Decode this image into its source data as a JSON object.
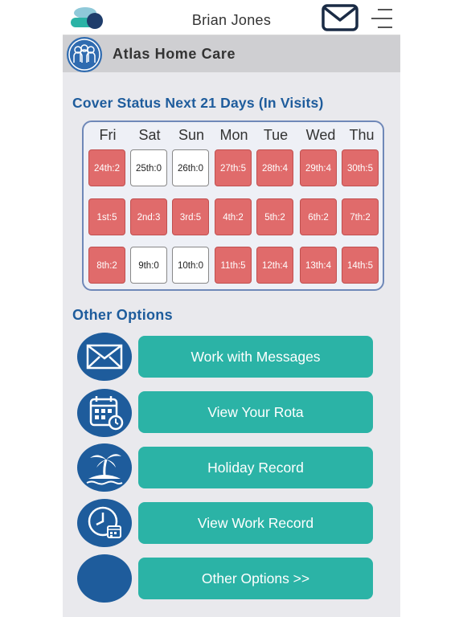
{
  "header": {
    "user_name": "Brian Jones"
  },
  "company": {
    "name": "Atlas Home Care"
  },
  "cover": {
    "title": "Cover Status Next 21 Days (In Visits)",
    "days": [
      "Fri",
      "Sat",
      "Sun",
      "Mon",
      "Tue",
      "Wed",
      "Thu"
    ],
    "weeks": [
      [
        {
          "label": "24th:2",
          "status": "red"
        },
        {
          "label": "25th:0",
          "status": "white"
        },
        {
          "label": "26th:0",
          "status": "white"
        },
        {
          "label": "27th:5",
          "status": "red"
        },
        {
          "label": "28th:4",
          "status": "red"
        },
        {
          "label": "29th:4",
          "status": "red"
        },
        {
          "label": "30th:5",
          "status": "red"
        }
      ],
      [
        {
          "label": "1st:5",
          "status": "red"
        },
        {
          "label": "2nd:3",
          "status": "red"
        },
        {
          "label": "3rd:5",
          "status": "red"
        },
        {
          "label": "4th:2",
          "status": "red"
        },
        {
          "label": "5th:2",
          "status": "red"
        },
        {
          "label": "6th:2",
          "status": "red"
        },
        {
          "label": "7th:2",
          "status": "red"
        }
      ],
      [
        {
          "label": "8th:2",
          "status": "red"
        },
        {
          "label": "9th:0",
          "status": "white"
        },
        {
          "label": "10th:0",
          "status": "white"
        },
        {
          "label": "11th:5",
          "status": "red"
        },
        {
          "label": "12th:4",
          "status": "red"
        },
        {
          "label": "13th:4",
          "status": "red"
        },
        {
          "label": "14th:5",
          "status": "red"
        }
      ]
    ],
    "colors": {
      "alert": "#e06b6b",
      "ok": "#ffffff"
    }
  },
  "options": {
    "title": "Other Options",
    "items": [
      {
        "label": "Work with Messages",
        "icon": "envelope-icon"
      },
      {
        "label": "View Your Rota",
        "icon": "calendar-icon"
      },
      {
        "label": "Holiday Record",
        "icon": "palm-tree-island-icon"
      },
      {
        "label": "View Work Record",
        "icon": "clock-calendar-icon"
      },
      {
        "label": "Other Options >>",
        "icon": "blank-circle-icon"
      }
    ]
  },
  "theme": {
    "brand_blue": "#1e5c9c",
    "button_teal": "#2bb3a6"
  }
}
